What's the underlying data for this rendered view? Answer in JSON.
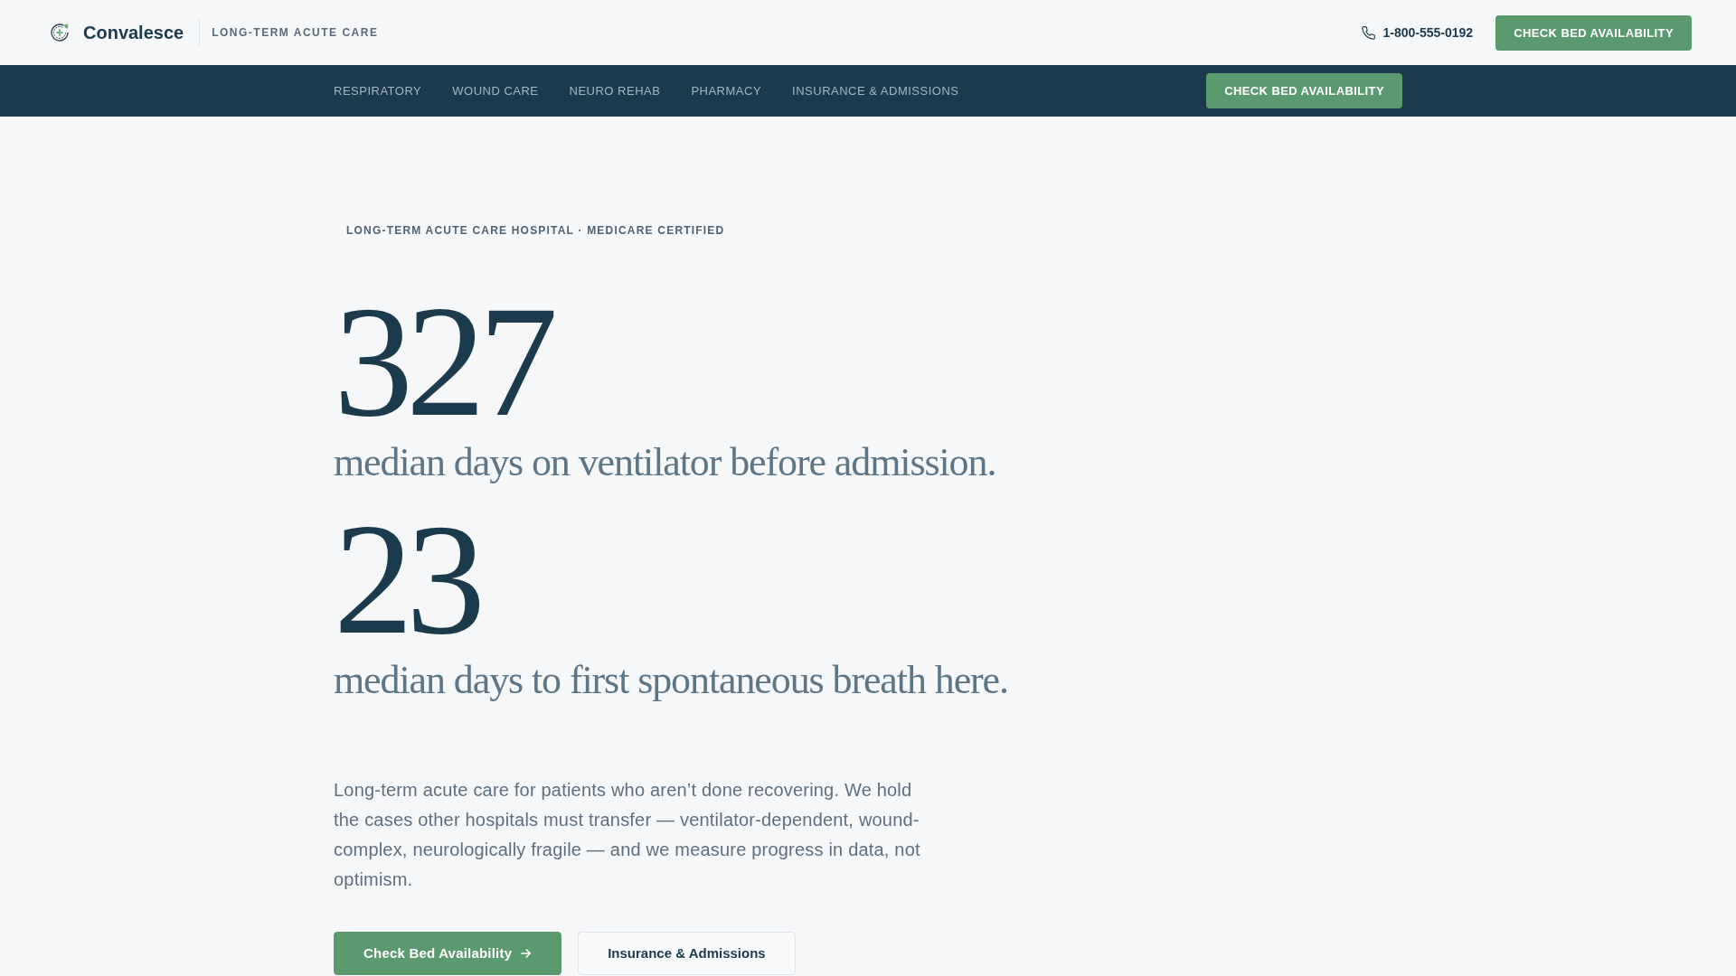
{
  "header": {
    "brand": "Convalesce",
    "tagline": "LONG-TERM ACUTE CARE",
    "phone": "1-800-555-0192",
    "cta": "CHECK BED AVAILABILITY"
  },
  "nav": {
    "items": [
      {
        "label": "RESPIRATORY"
      },
      {
        "label": "WOUND CARE"
      },
      {
        "label": "NEURO REHAB"
      },
      {
        "label": "PHARMACY"
      },
      {
        "label": "INSURANCE & ADMISSIONS"
      }
    ],
    "cta": "CHECK BED AVAILABILITY"
  },
  "hero": {
    "eyebrow": "LONG-TERM ACUTE CARE HOSPITAL · MEDICARE CERTIFIED",
    "stats": [
      {
        "value": "327",
        "caption": "median days on ventilator before admission."
      },
      {
        "value": "23",
        "caption": "median days to first spontaneous breath here."
      }
    ],
    "description": "Long-term acute care for patients who aren’t done recovering. We hold the cases other hospitals must transfer — ventilator-dependent, wound-complex, neurologically fragile — and we measure progress in data, not optimism.",
    "buttons": [
      {
        "label": "Check Bed Availability",
        "kind": "primary"
      },
      {
        "label": "Insurance & Admissions",
        "kind": "secondary"
      }
    ]
  }
}
